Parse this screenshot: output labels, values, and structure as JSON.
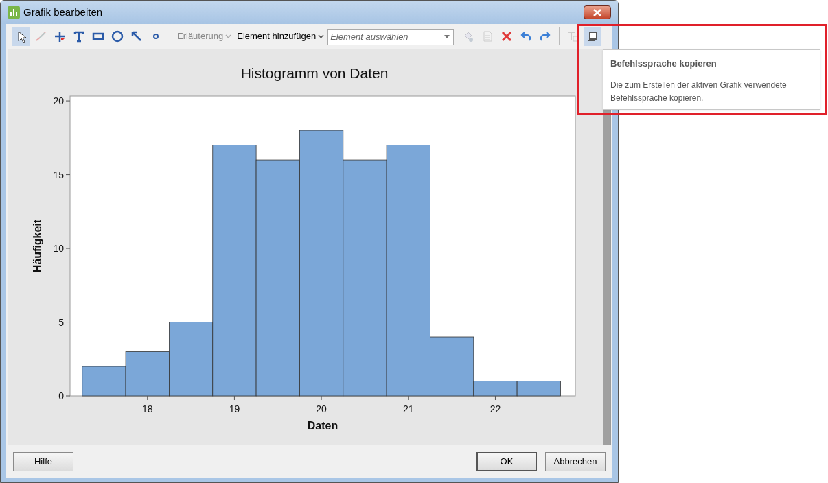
{
  "window": {
    "title": "Grafik bearbeiten"
  },
  "toolbar": [
    {
      "kind": "pointer",
      "selected": true,
      "disabled": false
    },
    {
      "kind": "brush",
      "selected": false,
      "disabled": true
    },
    {
      "kind": "crosshair",
      "selected": false,
      "disabled": false
    },
    {
      "kind": "text",
      "selected": false,
      "disabled": false
    },
    {
      "kind": "rectangle",
      "selected": false,
      "disabled": false
    },
    {
      "kind": "ellipse",
      "selected": false,
      "disabled": false
    },
    {
      "kind": "arrow",
      "selected": false,
      "disabled": false
    },
    {
      "kind": "dot",
      "selected": false,
      "disabled": false
    },
    {
      "kind": "separator"
    },
    {
      "kind": "dropdown",
      "label": "Erläuterung",
      "disabled": true
    },
    {
      "kind": "dropdown",
      "label": "Element hinzufügen",
      "disabled": false
    },
    {
      "kind": "combo",
      "placeholder": "Element auswählen"
    },
    {
      "kind": "fill",
      "selected": false,
      "disabled": true
    },
    {
      "kind": "document",
      "selected": false,
      "disabled": true
    },
    {
      "kind": "delete",
      "selected": false,
      "disabled": false
    },
    {
      "kind": "undo",
      "selected": false,
      "disabled": false
    },
    {
      "kind": "redo",
      "selected": false,
      "disabled": false
    },
    {
      "kind": "separator"
    },
    {
      "kind": "textformat",
      "selected": false,
      "disabled": true
    },
    {
      "kind": "scroll",
      "selected": true,
      "disabled": false
    }
  ],
  "chart": {
    "chart_data": {
      "type": "bar",
      "title": "Histogramm von Daten",
      "xlabel": "Daten",
      "ylabel": "Häufigkeit",
      "x": [
        17.5,
        18,
        18.5,
        19,
        19.5,
        20,
        20.5,
        21,
        21.5,
        22,
        22.5
      ],
      "values": [
        2,
        3,
        5,
        17,
        16,
        18,
        16,
        17,
        4,
        1,
        1
      ],
      "xlim": [
        17.11,
        22.92
      ],
      "ylim": [
        0,
        20.33
      ],
      "xticks": [
        18,
        19,
        20,
        21,
        22
      ],
      "yticks": [
        0,
        5,
        10,
        15,
        20
      ]
    }
  },
  "buttons": [
    {
      "label": "Hilfe",
      "default": false
    },
    {
      "label": "OK",
      "default": true
    },
    {
      "label": "Abbrechen",
      "default": false
    }
  ],
  "tooltip": {
    "title": "Befehlssprache kopieren",
    "text": "Die zum Erstellen der aktiven Grafik verwendete Befehlssprache kopieren."
  }
}
